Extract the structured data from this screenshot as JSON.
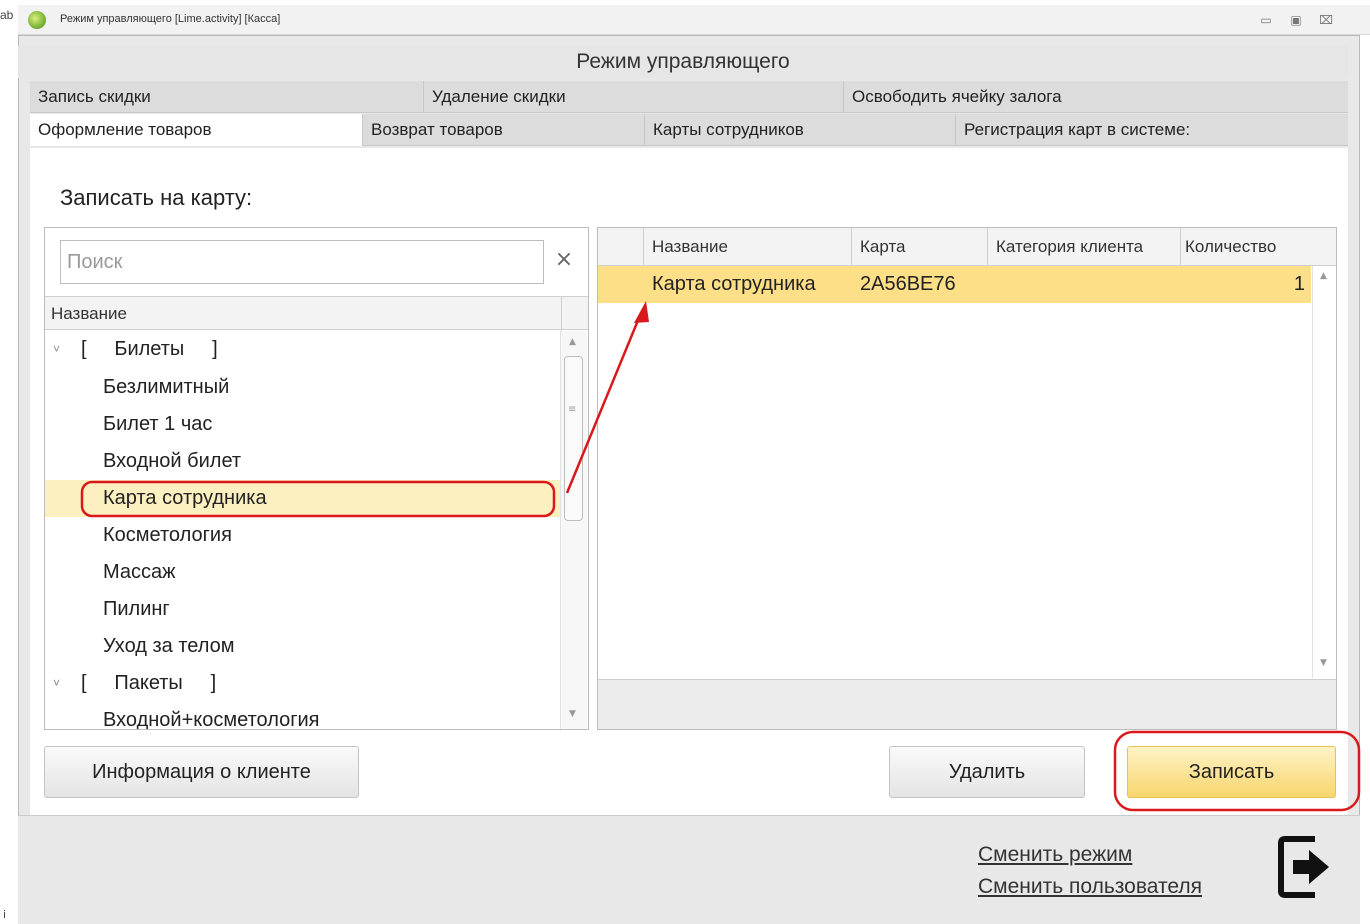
{
  "window": {
    "title": "Режим управляющего [Lime.activity] [Касса]",
    "left_edge_char": "ab",
    "left_edge_char_bottom": "i",
    "controls": {
      "minimize": "▭",
      "maximize": "▣",
      "close": "⌧"
    }
  },
  "header": {
    "title": "Режим управляющего"
  },
  "tabs_row1": [
    {
      "label": "Запись скидки"
    },
    {
      "label": "Удаление скидки"
    },
    {
      "label": "Освободить ячейку залога"
    }
  ],
  "tabs_row2": [
    {
      "label": "Оформление товаров",
      "active": true
    },
    {
      "label": "Возврат товаров"
    },
    {
      "label": "Карты сотрудников"
    },
    {
      "label": "Регистрация карт в системе:"
    }
  ],
  "section": {
    "title": "Записать на карту:"
  },
  "search": {
    "placeholder": "Поиск",
    "value": "",
    "clear_icon": "×"
  },
  "tree": {
    "column_header": "Название",
    "rows": [
      {
        "type": "group",
        "label": "[     Билеты     ]",
        "chevron": "˅"
      },
      {
        "type": "item",
        "label": "Безлимитный"
      },
      {
        "type": "item",
        "label": "Билет 1 час"
      },
      {
        "type": "item",
        "label": "Входной билет"
      },
      {
        "type": "item",
        "label": "Карта сотрудника",
        "selected": true
      },
      {
        "type": "item",
        "label": "Косметология"
      },
      {
        "type": "item",
        "label": "Массаж"
      },
      {
        "type": "item",
        "label": "Пилинг"
      },
      {
        "type": "item",
        "label": "Уход за телом"
      },
      {
        "type": "group",
        "label": "[     Пакеты     ]",
        "chevron": "˅"
      },
      {
        "type": "item",
        "label": "Входной+косметология"
      }
    ]
  },
  "grid": {
    "columns": [
      "Название",
      "Карта",
      "Категория клиента",
      "Количество"
    ],
    "rows": [
      {
        "name": "Карта сотрудника",
        "card": "2A56BE76",
        "category": "",
        "quantity": "1"
      }
    ]
  },
  "buttons": {
    "client_info": "Информация о клиенте",
    "delete": "Удалить",
    "write": "Записать"
  },
  "footer": {
    "change_mode": "Сменить режим",
    "change_user": "Сменить пользователя",
    "exit_icon": "exit-icon"
  },
  "colors": {
    "selected_row": "#fcdf86",
    "selected_tree": "#fcf0c0",
    "primary_button": "#f8d56d",
    "annotation": "#d9191c"
  }
}
